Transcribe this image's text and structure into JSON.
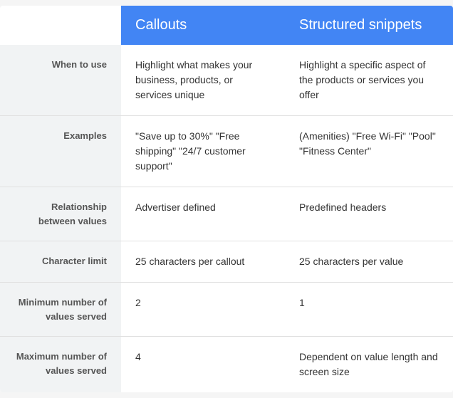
{
  "table": {
    "columns": {
      "label": "",
      "callouts": "Callouts",
      "structured_snippets": "Structured snippets"
    },
    "rows": [
      {
        "id": "when-to-use",
        "label": "When to use",
        "callouts_value": "Highlight what makes your business, products, or services unique",
        "snippets_value": "Highlight a specific aspect of the products or services you offer"
      },
      {
        "id": "examples",
        "label": "Examples",
        "callouts_value": "\"Save up to 30%\" \"Free shipping\" \"24/7 customer support\"",
        "snippets_value": "(Amenities) \"Free Wi-Fi\" \"Pool\" \"Fitness Center\""
      },
      {
        "id": "relationship",
        "label": "Relationship between values",
        "callouts_value": "Advertiser defined",
        "snippets_value": "Predefined headers"
      },
      {
        "id": "character-limit",
        "label": "Character limit",
        "callouts_value": "25 characters per callout",
        "snippets_value": "25 characters per value"
      },
      {
        "id": "minimum-values",
        "label": "Minimum number of values served",
        "callouts_value": "2",
        "snippets_value": "1"
      },
      {
        "id": "maximum-values",
        "label": "Maximum number of values served",
        "callouts_value": "4",
        "snippets_value": "Dependent on value length and screen size"
      }
    ]
  }
}
